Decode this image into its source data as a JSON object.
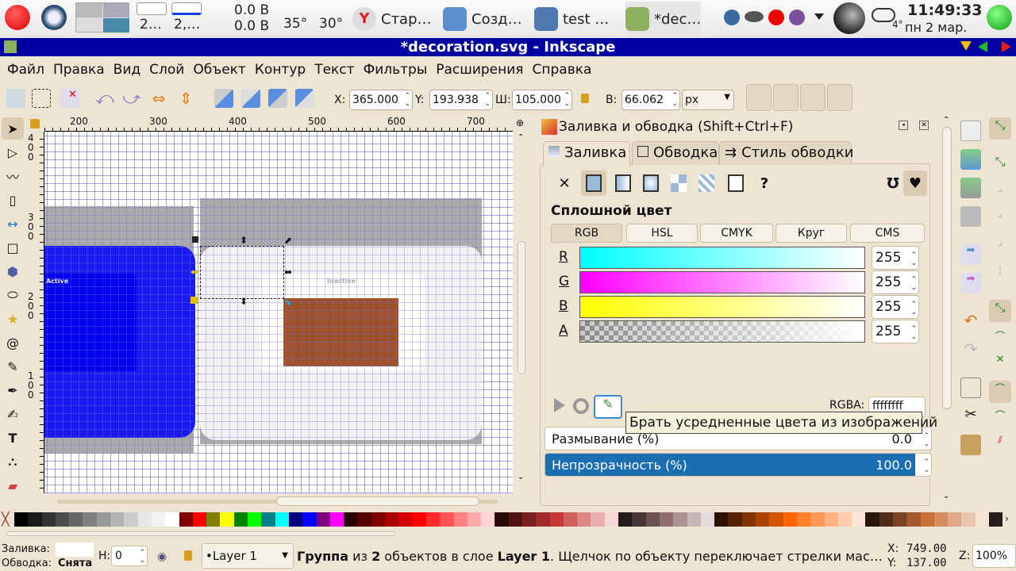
{
  "panel": {
    "net1": "2…",
    "net2": "2,…",
    "disk_read": "0.0 B",
    "disk_write": "0.0 B",
    "temp1": "35°",
    "temp2": "30°",
    "weather_temp": "4°",
    "clock_time": "11:49:33",
    "clock_date": "пн 2 мар.",
    "tasks": [
      {
        "label": "Стар…",
        "color": "#e02020"
      },
      {
        "label": "Созд…",
        "color": "#5b8fd0"
      },
      {
        "label": "test …",
        "color": "#5078b0"
      },
      {
        "label": "*dec…",
        "color": "#8fb060"
      }
    ]
  },
  "window": {
    "title": "*decoration.svg - Inkscape"
  },
  "menu": [
    "Файл",
    "Правка",
    "Вид",
    "Слой",
    "Объект",
    "Контур",
    "Текст",
    "Фильтры",
    "Расширения",
    "Справка"
  ],
  "toolbar": {
    "x_label": "X:",
    "x_value": "365.000",
    "y_label": "Y:",
    "y_value": "193.938",
    "w_label": "Ш:",
    "w_value": "105.000",
    "h_label": "В:",
    "h_value": "66.062",
    "unit": "px"
  },
  "ruler": {
    "h_ticks": [
      "200",
      "300",
      "400",
      "500",
      "600",
      "700"
    ],
    "v_ticks": [
      "4\n0\n0",
      "3\n0\n0",
      "2\n0\n0",
      "1\n0\n0"
    ]
  },
  "canvas": {
    "active_label": "Active",
    "inactive_label": "Inactive",
    "colors": {
      "active": "#1a1af0",
      "active_inner": "#0000ee",
      "inactive": "#f2f2f2",
      "brown": "#a0522d",
      "shadow": "#aaaaaa"
    }
  },
  "dialog": {
    "title": "Заливка и обводка (Shift+Ctrl+F)",
    "tabs": [
      "Заливка",
      "Обводка",
      "Стиль обводки"
    ],
    "unknown_fill": "?",
    "solid_label": "Сплошной цвет",
    "modes": [
      "RGB",
      "HSL",
      "CMYK",
      "Круг",
      "CMS"
    ],
    "channels": [
      {
        "label": "R",
        "value": "255"
      },
      {
        "label": "G",
        "value": "255"
      },
      {
        "label": "B",
        "value": "255"
      },
      {
        "label": "A",
        "value": "255"
      }
    ],
    "rgba_label": "RGBA:",
    "rgba_value": "ffffffff",
    "blur_label": "Размывание (%)",
    "blur_value": "0.0",
    "opacity_label": "Непрозрачность (%)",
    "opacity_value": "100.0",
    "opacity_percent": 100,
    "tooltip": "Брать усредненные цвета из изображений"
  },
  "palette": [
    "#000000",
    "#1a1a1a",
    "#333333",
    "#4d4d4d",
    "#666666",
    "#808080",
    "#999999",
    "#b3b3b3",
    "#cccccc",
    "#e6e6e6",
    "#f2f2f2",
    "#ffffff",
    "#800000",
    "#ff0000",
    "#808000",
    "#ffff00",
    "#008000",
    "#00ff00",
    "#008080",
    "#00ffff",
    "#000080",
    "#0000ff",
    "#800080",
    "#ff00ff",
    "#2b0000",
    "#550000",
    "#800000",
    "#aa0000",
    "#d40000",
    "#ff0000",
    "#ff2a2a",
    "#ff5555",
    "#ff8080",
    "#ffaaaa",
    "#ffd5d5",
    "#280b0b",
    "#501616",
    "#782121",
    "#a02c2c",
    "#c83737",
    "#d35f5f",
    "#de8787",
    "#e9afaf",
    "#f4d7d7",
    "#241c1c",
    "#483737",
    "#6c5353",
    "#916f6f",
    "#ac9393",
    "#c8b7b7",
    "#e3dbdb",
    "#2b1100",
    "#552200",
    "#803300",
    "#aa4400",
    "#d45500",
    "#ff6600",
    "#ff7f2a",
    "#ff9955",
    "#ffb380",
    "#ffccaa",
    "#ffe6d5",
    "#28170b",
    "#502d16",
    "#784421",
    "#a05a2c",
    "#c87137",
    "#d38d5f",
    "#deaa87",
    "#e9c6af",
    "#f4e3d7",
    "#241f1c",
    "#483e37",
    "#6c5d53",
    "#917c6f",
    "#ac9d93"
  ],
  "status": {
    "fill_label": "Заливка:",
    "stroke_label": "Обводка:",
    "stroke_value": "Снята",
    "h_label": "H:",
    "h_value": "0",
    "layer": "•Layer 1",
    "msg_b1": "Группа",
    "msg_1": " из ",
    "msg_b2": "2",
    "msg_2": " объектов в слое ",
    "msg_b3": "Layer 1",
    "msg_3": ". Щелчок по объекту переключает стрелки мас…",
    "cx_label": "X:",
    "cx": "749.00",
    "cy_label": "Y:",
    "cy": "137.00",
    "zoom_label": "Z:",
    "zoom": "100%"
  }
}
